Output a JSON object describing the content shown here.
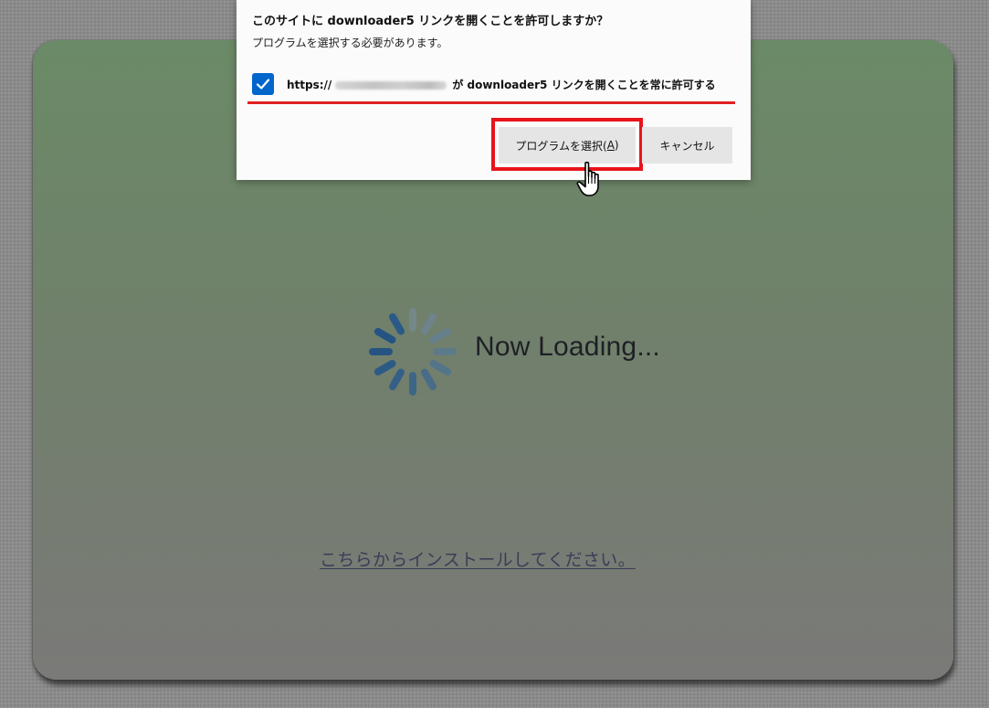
{
  "dialog": {
    "title": "このサイトに downloader5 リンクを開くことを許可しますか？",
    "subtitle": "プログラムを選択する必要があります。",
    "checkbox": {
      "checked": true,
      "label_prefix": "https://",
      "label_suffix": "が downloader5 リンクを開くことを常に許可する"
    },
    "choose_button": {
      "label": "プログラムを選択(",
      "access_key": "A",
      "label_end": ")"
    },
    "cancel_button": {
      "label": "キャンセル"
    }
  },
  "page": {
    "loading_text": "Now Loading...",
    "install_link": "こちらからインストールしてください。"
  },
  "icons": {
    "spinner": "loading-spinner-icon",
    "checkmark": "checkmark-icon",
    "cursor": "hand-pointer-icon"
  },
  "colors": {
    "panel": "#6b8a67",
    "highlight": "#e8141b",
    "checkbox": "#0066cc",
    "spinner": "#2f5d8a"
  }
}
